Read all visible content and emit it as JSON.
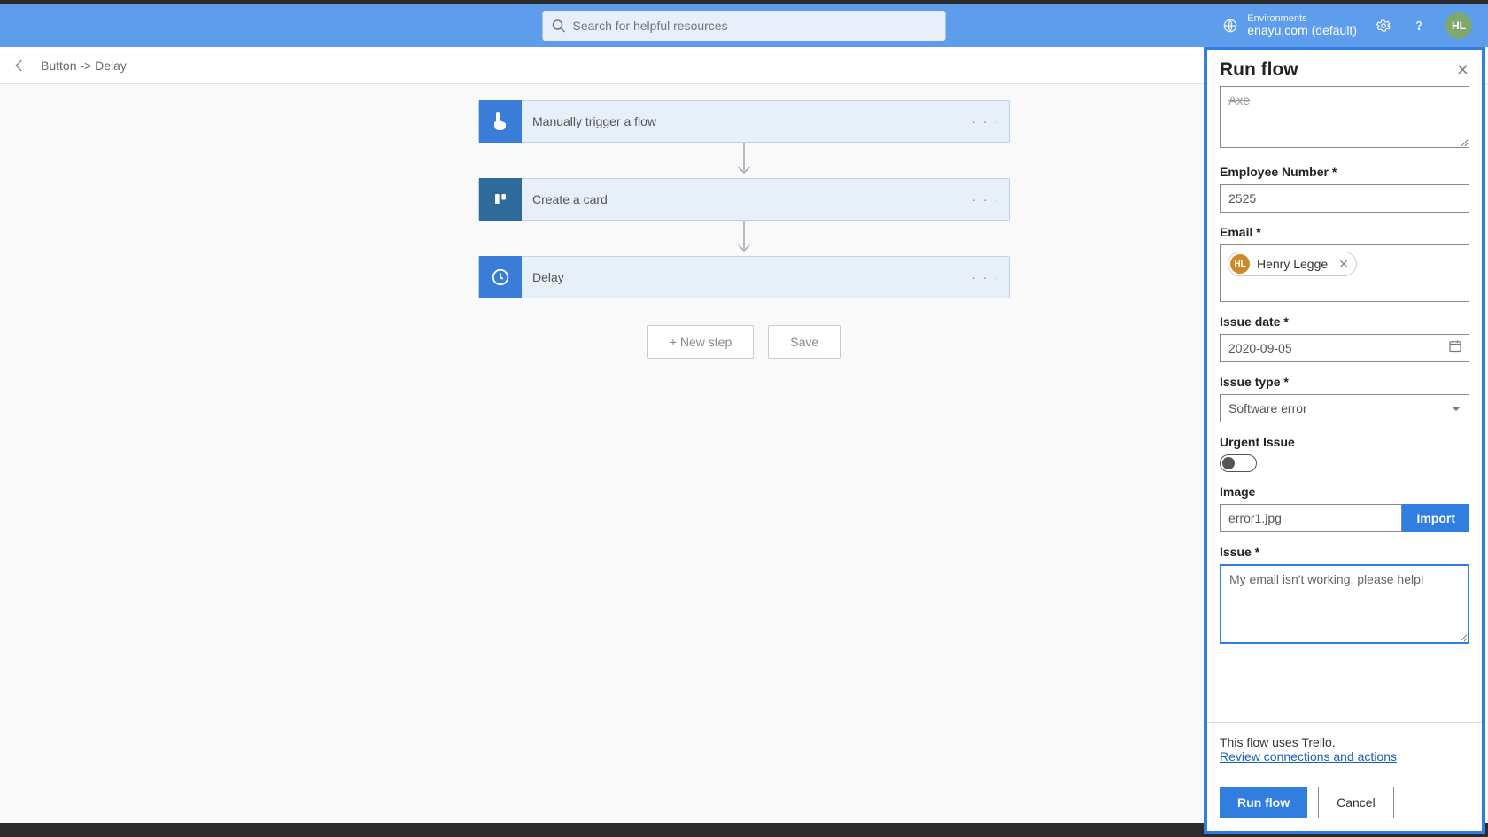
{
  "topbar": {
    "search_placeholder": "Search for helpful resources",
    "env_label": "Environments",
    "env_name": "enayu.com (default)",
    "avatar_initials": "HL"
  },
  "breadcrumb": "Button -> Delay",
  "flow": {
    "steps": [
      {
        "title": "Manually trigger a flow"
      },
      {
        "title": "Create a card"
      },
      {
        "title": "Delay"
      }
    ],
    "new_step": "+ New step",
    "save": "Save"
  },
  "panel": {
    "title": "Run flow",
    "scroll_top_value": "Axe",
    "employee_number_label": "Employee Number *",
    "employee_number_value": "2525",
    "email_label": "Email *",
    "email_chip_initials": "HL",
    "email_chip_name": "Henry Legge",
    "issue_date_label": "Issue date *",
    "issue_date_value": "2020-09-05",
    "issue_type_label": "Issue type *",
    "issue_type_value": "Software error",
    "urgent_label": "Urgent Issue",
    "image_label": "Image",
    "image_value": "error1.jpg",
    "import_label": "Import",
    "issue_label": "Issue *",
    "issue_value": "My email isn't working, please help!",
    "connections_text": "This flow uses Trello.",
    "review_link": "Review connections and actions",
    "run_label": "Run flow",
    "cancel_label": "Cancel"
  }
}
